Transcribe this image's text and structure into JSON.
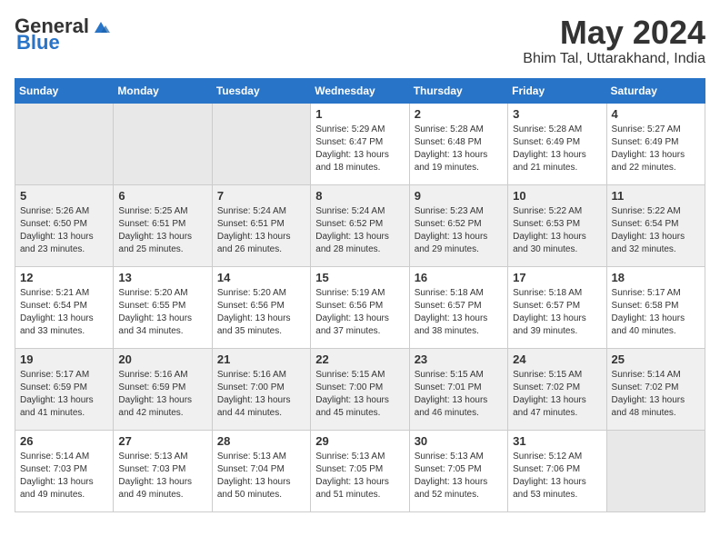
{
  "header": {
    "logo_general": "General",
    "logo_blue": "Blue",
    "month": "May 2024",
    "location": "Bhim Tal, Uttarakhand, India"
  },
  "days_of_week": [
    "Sunday",
    "Monday",
    "Tuesday",
    "Wednesday",
    "Thursday",
    "Friday",
    "Saturday"
  ],
  "weeks": [
    [
      {
        "day": "",
        "info": ""
      },
      {
        "day": "",
        "info": ""
      },
      {
        "day": "",
        "info": ""
      },
      {
        "day": "1",
        "info": "Sunrise: 5:29 AM\nSunset: 6:47 PM\nDaylight: 13 hours\nand 18 minutes."
      },
      {
        "day": "2",
        "info": "Sunrise: 5:28 AM\nSunset: 6:48 PM\nDaylight: 13 hours\nand 19 minutes."
      },
      {
        "day": "3",
        "info": "Sunrise: 5:28 AM\nSunset: 6:49 PM\nDaylight: 13 hours\nand 21 minutes."
      },
      {
        "day": "4",
        "info": "Sunrise: 5:27 AM\nSunset: 6:49 PM\nDaylight: 13 hours\nand 22 minutes."
      }
    ],
    [
      {
        "day": "5",
        "info": "Sunrise: 5:26 AM\nSunset: 6:50 PM\nDaylight: 13 hours\nand 23 minutes."
      },
      {
        "day": "6",
        "info": "Sunrise: 5:25 AM\nSunset: 6:51 PM\nDaylight: 13 hours\nand 25 minutes."
      },
      {
        "day": "7",
        "info": "Sunrise: 5:24 AM\nSunset: 6:51 PM\nDaylight: 13 hours\nand 26 minutes."
      },
      {
        "day": "8",
        "info": "Sunrise: 5:24 AM\nSunset: 6:52 PM\nDaylight: 13 hours\nand 28 minutes."
      },
      {
        "day": "9",
        "info": "Sunrise: 5:23 AM\nSunset: 6:52 PM\nDaylight: 13 hours\nand 29 minutes."
      },
      {
        "day": "10",
        "info": "Sunrise: 5:22 AM\nSunset: 6:53 PM\nDaylight: 13 hours\nand 30 minutes."
      },
      {
        "day": "11",
        "info": "Sunrise: 5:22 AM\nSunset: 6:54 PM\nDaylight: 13 hours\nand 32 minutes."
      }
    ],
    [
      {
        "day": "12",
        "info": "Sunrise: 5:21 AM\nSunset: 6:54 PM\nDaylight: 13 hours\nand 33 minutes."
      },
      {
        "day": "13",
        "info": "Sunrise: 5:20 AM\nSunset: 6:55 PM\nDaylight: 13 hours\nand 34 minutes."
      },
      {
        "day": "14",
        "info": "Sunrise: 5:20 AM\nSunset: 6:56 PM\nDaylight: 13 hours\nand 35 minutes."
      },
      {
        "day": "15",
        "info": "Sunrise: 5:19 AM\nSunset: 6:56 PM\nDaylight: 13 hours\nand 37 minutes."
      },
      {
        "day": "16",
        "info": "Sunrise: 5:18 AM\nSunset: 6:57 PM\nDaylight: 13 hours\nand 38 minutes."
      },
      {
        "day": "17",
        "info": "Sunrise: 5:18 AM\nSunset: 6:57 PM\nDaylight: 13 hours\nand 39 minutes."
      },
      {
        "day": "18",
        "info": "Sunrise: 5:17 AM\nSunset: 6:58 PM\nDaylight: 13 hours\nand 40 minutes."
      }
    ],
    [
      {
        "day": "19",
        "info": "Sunrise: 5:17 AM\nSunset: 6:59 PM\nDaylight: 13 hours\nand 41 minutes."
      },
      {
        "day": "20",
        "info": "Sunrise: 5:16 AM\nSunset: 6:59 PM\nDaylight: 13 hours\nand 42 minutes."
      },
      {
        "day": "21",
        "info": "Sunrise: 5:16 AM\nSunset: 7:00 PM\nDaylight: 13 hours\nand 44 minutes."
      },
      {
        "day": "22",
        "info": "Sunrise: 5:15 AM\nSunset: 7:00 PM\nDaylight: 13 hours\nand 45 minutes."
      },
      {
        "day": "23",
        "info": "Sunrise: 5:15 AM\nSunset: 7:01 PM\nDaylight: 13 hours\nand 46 minutes."
      },
      {
        "day": "24",
        "info": "Sunrise: 5:15 AM\nSunset: 7:02 PM\nDaylight: 13 hours\nand 47 minutes."
      },
      {
        "day": "25",
        "info": "Sunrise: 5:14 AM\nSunset: 7:02 PM\nDaylight: 13 hours\nand 48 minutes."
      }
    ],
    [
      {
        "day": "26",
        "info": "Sunrise: 5:14 AM\nSunset: 7:03 PM\nDaylight: 13 hours\nand 49 minutes."
      },
      {
        "day": "27",
        "info": "Sunrise: 5:13 AM\nSunset: 7:03 PM\nDaylight: 13 hours\nand 49 minutes."
      },
      {
        "day": "28",
        "info": "Sunrise: 5:13 AM\nSunset: 7:04 PM\nDaylight: 13 hours\nand 50 minutes."
      },
      {
        "day": "29",
        "info": "Sunrise: 5:13 AM\nSunset: 7:05 PM\nDaylight: 13 hours\nand 51 minutes."
      },
      {
        "day": "30",
        "info": "Sunrise: 5:13 AM\nSunset: 7:05 PM\nDaylight: 13 hours\nand 52 minutes."
      },
      {
        "day": "31",
        "info": "Sunrise: 5:12 AM\nSunset: 7:06 PM\nDaylight: 13 hours\nand 53 minutes."
      },
      {
        "day": "",
        "info": ""
      }
    ]
  ]
}
